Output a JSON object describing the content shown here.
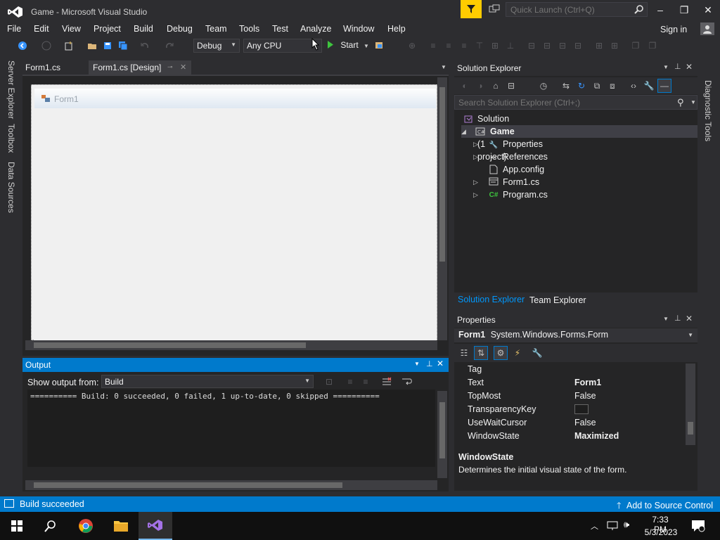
{
  "window": {
    "title": "Game - Microsoft Visual Studio",
    "quick_launch_placeholder": "Quick Launch (Ctrl+Q)",
    "min_glyph": "–",
    "max_glyph": "❐",
    "close_glyph": "✕"
  },
  "menu": {
    "items": [
      "File",
      "Edit",
      "View",
      "Project",
      "Build",
      "Debug",
      "Team",
      "Tools",
      "Test",
      "Analyze",
      "Window",
      "Help"
    ],
    "sign_in": "Sign in"
  },
  "toolbar": {
    "config": "Debug",
    "platform": "Any CPU",
    "start_label": "Start"
  },
  "left_tabs": [
    "Server Explorer",
    "Toolbox",
    "Data Sources"
  ],
  "doc_tabs": [
    {
      "label": "Form1.cs"
    },
    {
      "label": "Form1.cs [Design]"
    }
  ],
  "designer": {
    "form_title": "Form1"
  },
  "output": {
    "title": "Output",
    "show_from_label": "Show output from:",
    "source": "Build",
    "text": "========== Build: 0 succeeded, 0 failed, 1 up-to-date, 0 skipped =========="
  },
  "solution_explorer": {
    "title": "Solution Explorer",
    "search_placeholder": "Search Solution Explorer (Ctrl+;)",
    "tree": [
      {
        "label": "Solution 'Game' (1 project)"
      },
      {
        "label": "Game"
      },
      {
        "label": "Properties"
      },
      {
        "label": "References"
      },
      {
        "label": "App.config"
      },
      {
        "label": "Form1.cs"
      },
      {
        "label": "Program.cs"
      }
    ],
    "bottom_tabs": [
      "Solution Explorer",
      "Team Explorer"
    ]
  },
  "properties": {
    "title": "Properties",
    "object_name": "Form1",
    "object_type": "System.Windows.Forms.Form",
    "rows": [
      {
        "name": "Tag",
        "value": ""
      },
      {
        "name": "Text",
        "value": "Form1"
      },
      {
        "name": "TopMost",
        "value": "False"
      },
      {
        "name": "TransparencyKey",
        "value": ""
      },
      {
        "name": "UseWaitCursor",
        "value": "False"
      },
      {
        "name": "WindowState",
        "value": "Maximized"
      }
    ],
    "desc_title": "WindowState",
    "desc_text": "Determines the initial visual state of the form."
  },
  "right_tabs": [
    "Diagnostic Tools"
  ],
  "status": {
    "text": "Build succeeded",
    "source_control": "Add to Source Control"
  },
  "taskbar": {
    "time": "7:33 PM",
    "date": "5/3/2023"
  },
  "colors": {
    "accent": "#007acc",
    "background": "#2d2d30",
    "panel": "#252526",
    "filter_yellow": "#ffcc00"
  }
}
